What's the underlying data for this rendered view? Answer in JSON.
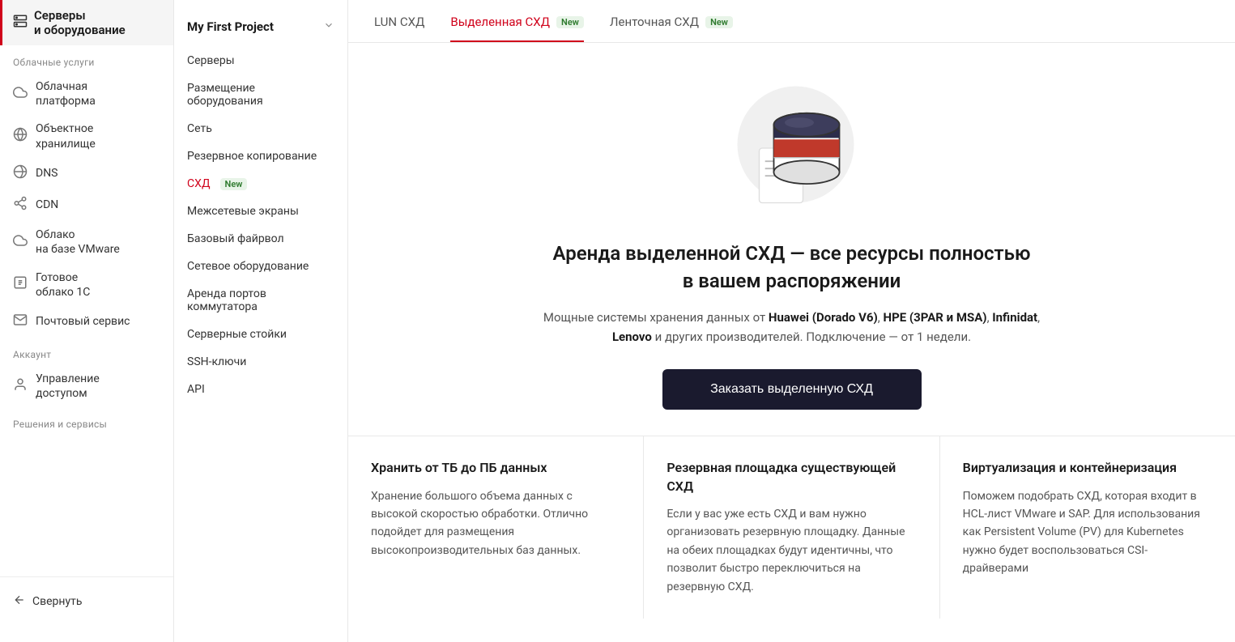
{
  "sidebar": {
    "active_item": {
      "label_line1": "Серверы",
      "label_line2": "и оборудование"
    },
    "sections": [
      {
        "label": "Облачные услуги",
        "items": [
          {
            "id": "cloud-platform",
            "label_line1": "Облачная",
            "label_line2": "платформа",
            "icon": "cloud"
          },
          {
            "id": "object-storage",
            "label_line1": "Объектное",
            "label_line2": "хранилище",
            "icon": "globe"
          },
          {
            "id": "dns",
            "label": "DNS",
            "icon": "globe"
          },
          {
            "id": "cdn",
            "label": "CDN",
            "icon": "share"
          },
          {
            "id": "vmware",
            "label_line1": "Облако",
            "label_line2": "на базе VMware",
            "icon": "cloud"
          },
          {
            "id": "1c",
            "label_line1": "Готовое",
            "label_line2": "облако 1С",
            "icon": "cube"
          },
          {
            "id": "mail",
            "label": "Почтовый сервис",
            "icon": "mail"
          }
        ]
      },
      {
        "label": "Аккаунт",
        "items": [
          {
            "id": "access-management",
            "label_line1": "Управление",
            "label_line2": "доступом",
            "icon": "user"
          }
        ]
      },
      {
        "label": "Решения и сервисы",
        "items": []
      }
    ],
    "bottom": {
      "collapse_label": "Свернуть"
    }
  },
  "middle_nav": {
    "project_name": "My First Project",
    "items": [
      {
        "id": "servers",
        "label": "Серверы",
        "active": false
      },
      {
        "id": "hardware-placement",
        "label_line1": "Размещение",
        "label_line2": "оборудования",
        "active": false
      },
      {
        "id": "network",
        "label": "Сеть",
        "active": false
      },
      {
        "id": "backup",
        "label": "Резервное копирование",
        "active": false
      },
      {
        "id": "storage",
        "label": "СХД",
        "badge": "New",
        "active": true
      },
      {
        "id": "firewalls",
        "label": "Межсетевые экраны",
        "active": false
      },
      {
        "id": "basic-firewall",
        "label": "Базовый файрвол",
        "active": false
      },
      {
        "id": "network-equipment",
        "label": "Сетевое оборудование",
        "active": false
      },
      {
        "id": "port-rental",
        "label_line1": "Аренда портов",
        "label_line2": "коммутатора",
        "active": false
      },
      {
        "id": "server-racks",
        "label": "Серверные стойки",
        "active": false
      },
      {
        "id": "ssh-keys",
        "label": "SSH-ключи",
        "active": false
      },
      {
        "id": "api",
        "label": "API",
        "active": false
      }
    ]
  },
  "tabs": [
    {
      "id": "lun",
      "label": "LUN СХД",
      "active": false,
      "badge": null
    },
    {
      "id": "dedicated",
      "label": "Выделенная СХД",
      "active": true,
      "badge": "New"
    },
    {
      "id": "tape",
      "label": "Ленточная СХД",
      "active": false,
      "badge": "New"
    }
  ],
  "hero": {
    "title": "Аренда выделенной СХД — все ресурсы полностью в вашем распоряжении",
    "description": "Мощные системы хранения данных от Huawei (Dorado V6), HPE (3PAR и MSA), Infinidat, Lenovo и других производителей. Подключение — от 1 недели.",
    "order_button": "Заказать выделенную СХД"
  },
  "features": [
    {
      "id": "storage-capacity",
      "title": "Хранить от ТБ до ПБ данных",
      "desc": "Хранение большого объема данных с высокой скоростью обработки. Отлично подойдет для размещения высокопроизводительных баз данных."
    },
    {
      "id": "backup-site",
      "title": "Резервная площадка существующей СХД",
      "desc": "Если у вас уже есть СХД и вам нужно организовать резервную площадку. Данные на обеих площадках будут идентичны, что позволит быстро переключиться на резервную СХД."
    },
    {
      "id": "virtualization",
      "title": "Виртуализация и контейнеризация",
      "desc": "Поможем подобрать СХД, которая входит в HCL-лист VMware и SAP. Для использования как Persistent Volume (PV) для Kubernetes нужно будет воспользоваться CSI-драйверами"
    }
  ]
}
